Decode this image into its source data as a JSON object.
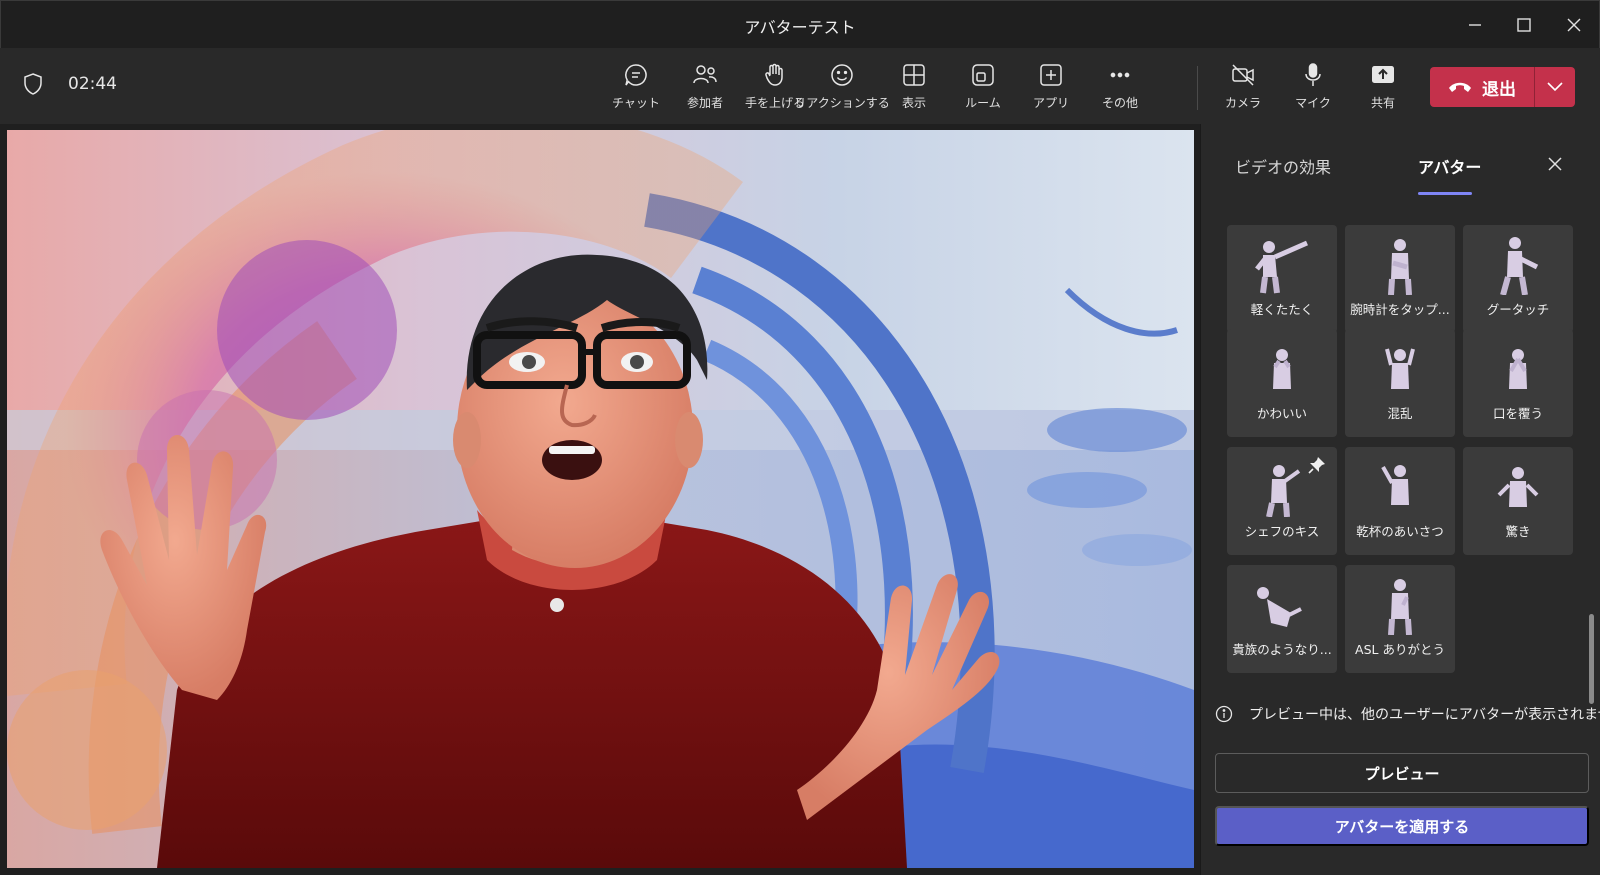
{
  "window": {
    "title": "アバターテスト"
  },
  "toolbar": {
    "timer": "02:44",
    "buttons": [
      {
        "id": "chat",
        "label": "チャット",
        "icon": "chat-icon"
      },
      {
        "id": "people",
        "label": "参加者",
        "icon": "people-icon"
      },
      {
        "id": "raise-hand",
        "label": "手を上げる",
        "icon": "hand-icon"
      },
      {
        "id": "react",
        "label": "リアクションする",
        "icon": "smile-icon"
      },
      {
        "id": "view",
        "label": "表示",
        "icon": "grid-icon"
      },
      {
        "id": "rooms",
        "label": "ルーム",
        "icon": "rooms-icon"
      },
      {
        "id": "apps",
        "label": "アプリ",
        "icon": "plus-square-icon"
      },
      {
        "id": "more",
        "label": "その他",
        "icon": "more-icon"
      },
      {
        "id": "camera",
        "label": "カメラ",
        "icon": "camera-off-icon"
      },
      {
        "id": "mic",
        "label": "マイク",
        "icon": "mic-icon"
      },
      {
        "id": "share",
        "label": "共有",
        "icon": "share-icon"
      }
    ],
    "leave_label": "退出",
    "leave_color": "#c4314b"
  },
  "panel": {
    "tabs": [
      {
        "label": "ビデオの効果",
        "active": false
      },
      {
        "label": "アバター",
        "active": true
      }
    ],
    "reactions": [
      "軽くたたく",
      "腕時計をタップ...",
      "グータッチ",
      "かわいい",
      "混乱",
      "口を覆う",
      "シェフのキス",
      "乾杯のあいさつ",
      "驚き",
      "貴族のようなり...",
      "ASL ありがとう"
    ],
    "notice": "プレビュー中は、他のユーザーにアバターが表示されません。",
    "preview_label": "プレビュー",
    "apply_label": "アバターを適用する",
    "accent": "#5b5fc7"
  }
}
